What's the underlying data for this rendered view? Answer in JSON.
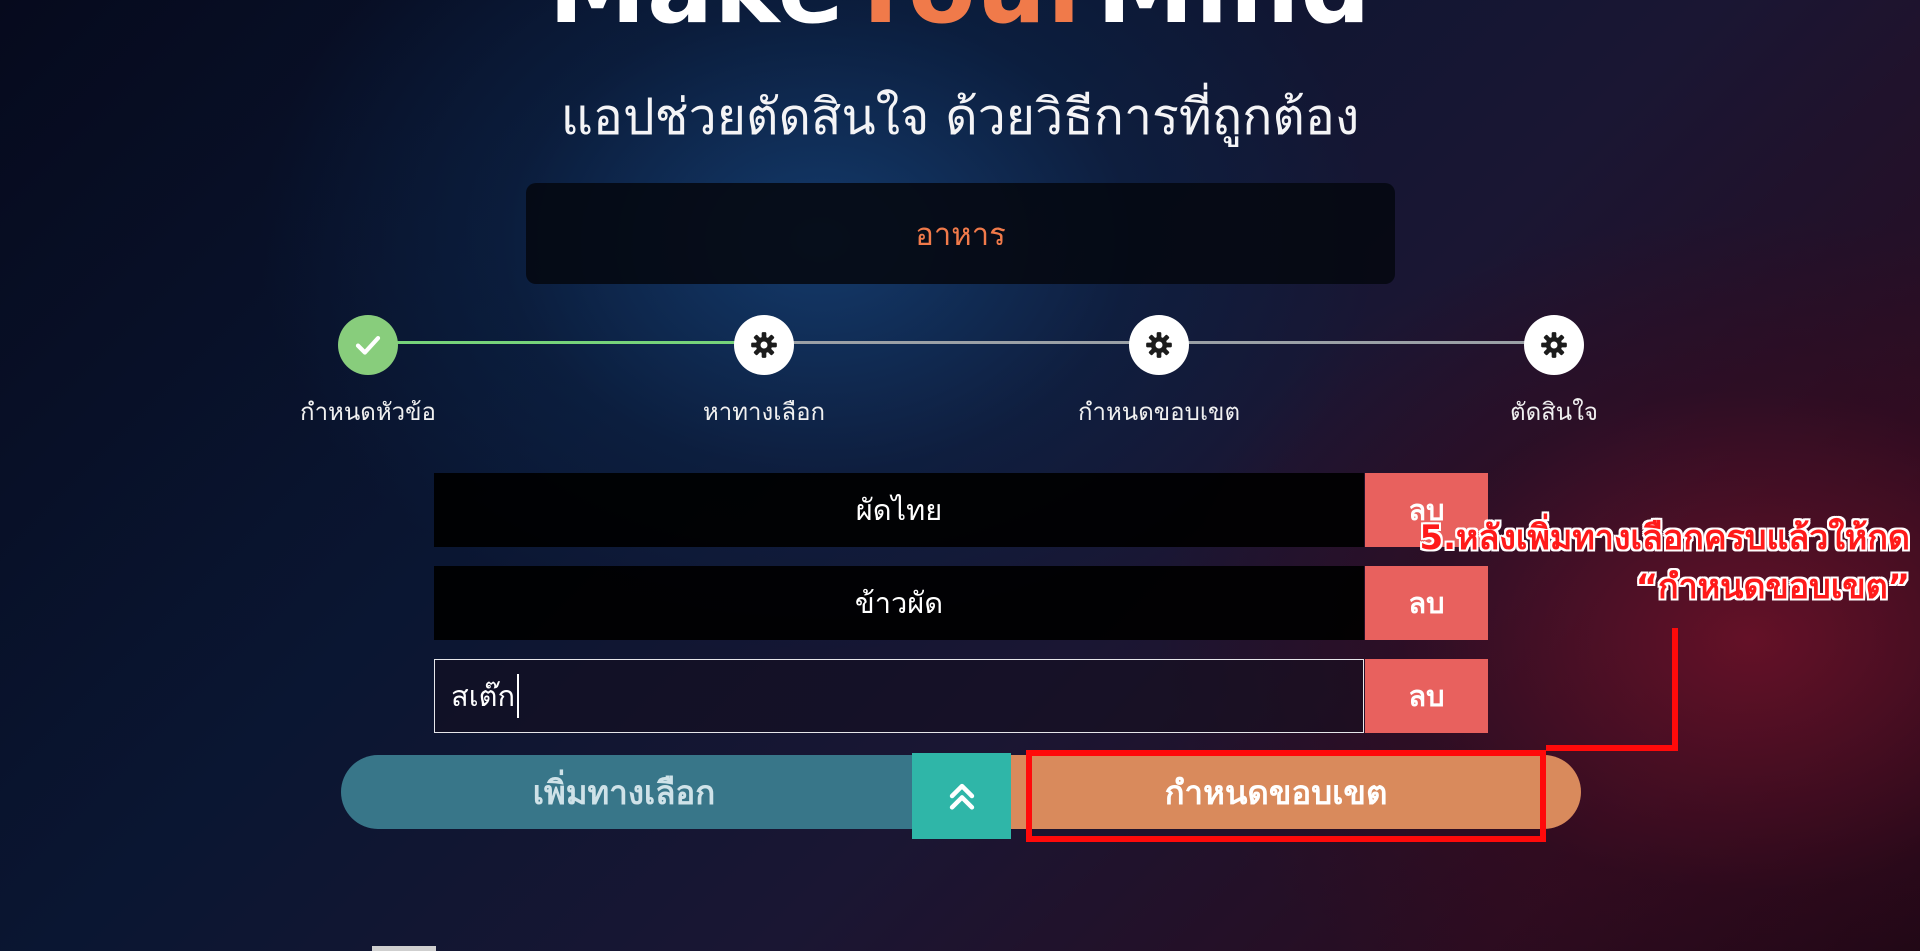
{
  "app": {
    "logo": {
      "part1": "Make",
      "part2": "Your",
      "part3": "Mind"
    },
    "subtitle": "แอปช่วยตัดสินใจ ด้วยวิธีการที่ถูกต้อง",
    "topic": "อาหาร"
  },
  "steps": [
    {
      "label": "กำหนดหัวข้อ",
      "status": "done",
      "icon": "check-icon"
    },
    {
      "label": "หาทางเลือก",
      "status": "pending",
      "icon": "gear-icon"
    },
    {
      "label": "กำหนดขอบเขต",
      "status": "pending",
      "icon": "gear-icon"
    },
    {
      "label": "ตัดสินใจ",
      "status": "pending",
      "icon": "gear-icon"
    }
  ],
  "options": [
    {
      "value": "ผัดไทย",
      "delete_label": "ลบ"
    },
    {
      "value": "ข้าวผัด",
      "delete_label": "ลบ"
    },
    {
      "value": "สเต๊ก",
      "delete_label": "ลบ",
      "editing": true
    }
  ],
  "actions": {
    "add_option_label": "เพิ่มทางเลือก",
    "up_icon": "chevron-double-up-icon",
    "set_boundary_label": "กำหนดขอบเขต"
  },
  "annotation": {
    "line1": "5.หลังเพิ่มทางเลือกครบแล้วให้กด",
    "line2": "“กำหนดขอบเขต”"
  },
  "colors": {
    "accent_orange": "#f07a4a",
    "done_green": "#88cd7c",
    "delete_red": "#e8615e",
    "add_teal": "#387689",
    "up_teal": "#2fb6a8",
    "boundary_orange": "#d98a5c",
    "annotation_red": "#ff0a0a"
  }
}
